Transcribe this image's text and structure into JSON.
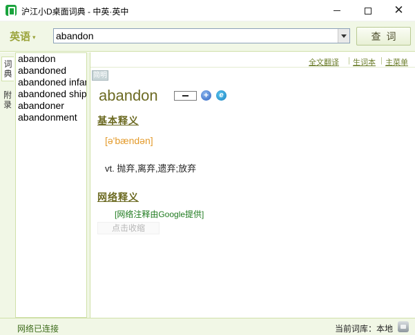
{
  "window": {
    "title": "沪江小D桌面词典 - 中英·英中",
    "minimize_icon": "minimize-icon",
    "maximize_icon": "maximize-icon",
    "close_icon": "close-icon",
    "close_glyph": "✕"
  },
  "toolbar": {
    "language": "英语",
    "search_value": "abandon",
    "lookup_label": "查词"
  },
  "side_tabs": {
    "dictionary": "词典",
    "appendix": "附录"
  },
  "word_list": [
    "abandon",
    "abandoned",
    "abandoned infant",
    "abandoned ship",
    "abandoner",
    "abandonment"
  ],
  "content": {
    "links": {
      "fulltext_translate": "全文翻译",
      "vocab_book": "生词本",
      "main_menu": "主菜单"
    },
    "dict_badge": "简明",
    "headword": "abandon",
    "plus_glyph": "+",
    "ie_glyph": "e",
    "basic_title": "基本释义",
    "phonetic": "[ə'bændən]",
    "definition": "vt. 抛弃,离弃,遗弃;放弃",
    "web_title": "网络释义",
    "google_note": "[网络注释由Google提供]",
    "collect_label": "点击收缩"
  },
  "status": {
    "connection": "网络已连接",
    "current_library": "当前词库：本地"
  },
  "colors": {
    "accent": "#6c6a22",
    "phonetic": "#e39a2a",
    "panel_bg": "#f1f7e6",
    "border": "#cfe0a8",
    "link": "#6e7f2e"
  }
}
